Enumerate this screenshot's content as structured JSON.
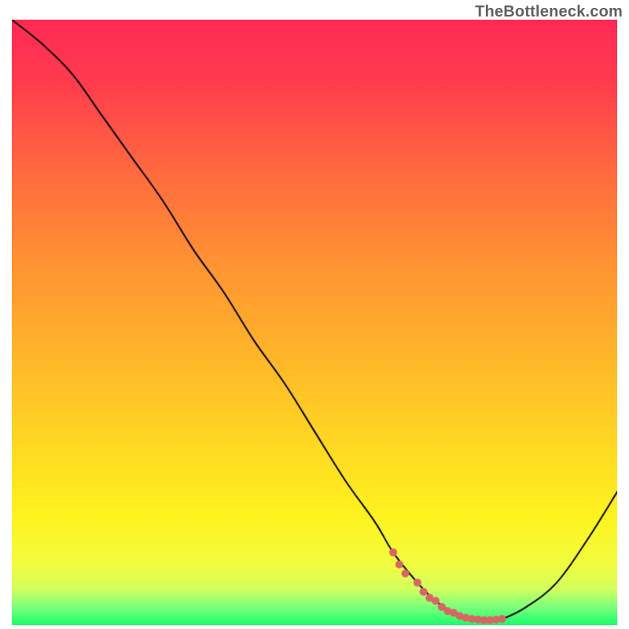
{
  "watermark": "TheBottleneck.com",
  "chart_data": {
    "type": "line",
    "title": "",
    "xlabel": "",
    "ylabel": "",
    "xlim": [
      0,
      100
    ],
    "ylim": [
      0,
      100
    ],
    "x": [
      0,
      5,
      10,
      15,
      20,
      25,
      30,
      35,
      40,
      45,
      50,
      55,
      60,
      63,
      67,
      70,
      73,
      76,
      79,
      81,
      85,
      90,
      95,
      100
    ],
    "curve_y": [
      100,
      96,
      91,
      84,
      77,
      70,
      62,
      55,
      47,
      40,
      32,
      24,
      17,
      12,
      7,
      4,
      2,
      1,
      0.8,
      1,
      3,
      7,
      14,
      22
    ],
    "optimal_region": {
      "x_start": 63,
      "x_end": 81,
      "y_start": 0,
      "y_end": 3
    },
    "markers": {
      "x": [
        63,
        64,
        65,
        67,
        68,
        69,
        70,
        71,
        72,
        73,
        74,
        75,
        76,
        77,
        78,
        79,
        80,
        81
      ],
      "y": [
        12,
        10,
        8.5,
        7,
        5.5,
        4.5,
        4,
        3,
        2.3,
        2,
        1.5,
        1.2,
        1,
        0.9,
        0.8,
        0.8,
        0.9,
        1
      ],
      "color": "#d96565",
      "radius": 5
    },
    "gradient_stops": [
      {
        "pct": 0.0,
        "color": "#ff2a55"
      },
      {
        "pct": 0.1,
        "color": "#ff3b4e"
      },
      {
        "pct": 0.25,
        "color": "#ff6a3f"
      },
      {
        "pct": 0.4,
        "color": "#ff9233"
      },
      {
        "pct": 0.55,
        "color": "#ffb52a"
      },
      {
        "pct": 0.7,
        "color": "#ffd823"
      },
      {
        "pct": 0.82,
        "color": "#fff31f"
      },
      {
        "pct": 0.9,
        "color": "#f2fd40"
      },
      {
        "pct": 0.94,
        "color": "#d4ff5e"
      },
      {
        "pct": 0.97,
        "color": "#7dff7d"
      },
      {
        "pct": 1.0,
        "color": "#1aff6a"
      }
    ],
    "curve_color": "#000000",
    "curve_width": 2
  }
}
